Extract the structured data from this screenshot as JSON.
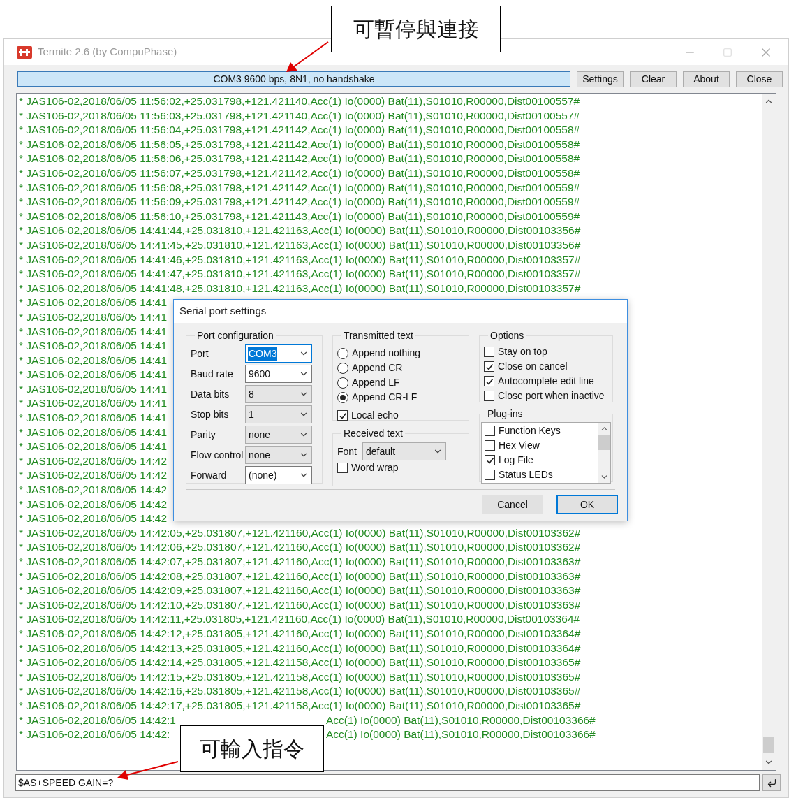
{
  "callouts": [
    {
      "text": "可暫停與連接"
    },
    {
      "text": "可輸入指令"
    }
  ],
  "window": {
    "title": "Termite 2.6 (by CompuPhase)"
  },
  "toolbar": {
    "status": "COM3 9600 bps, 8N1, no handshake",
    "buttons": [
      "Settings",
      "Clear",
      "About",
      "Close"
    ]
  },
  "log": {
    "lines": [
      {
        "text": "* JAS106-02,2018/06/05 11:56:02,+25.031798,+121.421140,Acc(1) Io(0000) Bat(11),S01010,R00000,Dist00100557#"
      },
      {
        "text": "* JAS106-02,2018/06/05 11:56:03,+25.031798,+121.421140,Acc(1) Io(0000) Bat(11),S01010,R00000,Dist00100557#"
      },
      {
        "text": "* JAS106-02,2018/06/05 11:56:04,+25.031798,+121.421142,Acc(1) Io(0000) Bat(11),S01010,R00000,Dist00100558#"
      },
      {
        "text": "* JAS106-02,2018/06/05 11:56:05,+25.031798,+121.421142,Acc(1) Io(0000) Bat(11),S01010,R00000,Dist00100558#"
      },
      {
        "text": "* JAS106-02,2018/06/05 11:56:06,+25.031798,+121.421142,Acc(1) Io(0000) Bat(11),S01010,R00000,Dist00100558#"
      },
      {
        "text": "* JAS106-02,2018/06/05 11:56:07,+25.031798,+121.421142,Acc(1) Io(0000) Bat(11),S01010,R00000,Dist00100558#"
      },
      {
        "text": "* JAS106-02,2018/06/05 11:56:08,+25.031798,+121.421142,Acc(1) Io(0000) Bat(11),S01010,R00000,Dist00100559#"
      },
      {
        "text": "* JAS106-02,2018/06/05 11:56:09,+25.031798,+121.421142,Acc(1) Io(0000) Bat(11),S01010,R00000,Dist00100559#"
      },
      {
        "text": "* JAS106-02,2018/06/05 11:56:10,+25.031798,+121.421143,Acc(1) Io(0000) Bat(11),S01010,R00000,Dist00100559#"
      },
      {
        "text": "* JAS106-02,2018/06/05 14:41:44,+25.031810,+121.421163,Acc(1) Io(0000) Bat(11),S01010,R00000,Dist00103356#"
      },
      {
        "text": "* JAS106-02,2018/06/05 14:41:45,+25.031810,+121.421163,Acc(1) Io(0000) Bat(11),S01010,R00000,Dist00103356#"
      },
      {
        "text": "* JAS106-02,2018/06/05 14:41:46,+25.031810,+121.421163,Acc(1) Io(0000) Bat(11),S01010,R00000,Dist00103357#"
      },
      {
        "text": "* JAS106-02,2018/06/05 14:41:47,+25.031810,+121.421163,Acc(1) Io(0000) Bat(11),S01010,R00000,Dist00103357#"
      },
      {
        "text": "* JAS106-02,2018/06/05 14:41:48,+25.031810,+121.421163,Acc(1) Io(0000) Bat(11),S01010,R00000,Dist00103357#"
      },
      {
        "text": "* JAS106-02,2018/06/05 14:41"
      },
      {
        "text": "* JAS106-02,2018/06/05 14:41"
      },
      {
        "text": "* JAS106-02,2018/06/05 14:41"
      },
      {
        "text": "* JAS106-02,2018/06/05 14:41"
      },
      {
        "text": "* JAS106-02,2018/06/05 14:41"
      },
      {
        "text": "* JAS106-02,2018/06/05 14:41"
      },
      {
        "text": "* JAS106-02,2018/06/05 14:41"
      },
      {
        "text": "* JAS106-02,2018/06/05 14:41"
      },
      {
        "text": "* JAS106-02,2018/06/05 14:41"
      },
      {
        "text": "* JAS106-02,2018/06/05 14:41"
      },
      {
        "text": "* JAS106-02,2018/06/05 14:41"
      },
      {
        "text": "* JAS106-02,2018/06/05 14:42"
      },
      {
        "text": "* JAS106-02,2018/06/05 14:42"
      },
      {
        "text": "* JAS106-02,2018/06/05 14:42"
      },
      {
        "text": "* JAS106-02,2018/06/05 14:42"
      },
      {
        "text": "* JAS106-02,2018/06/05 14:42"
      },
      {
        "text": "* JAS106-02,2018/06/05 14:42:05,+25.031807,+121.421160,Acc(1) Io(0000) Bat(11),S01010,R00000,Dist00103362#"
      },
      {
        "text": "* JAS106-02,2018/06/05 14:42:06,+25.031807,+121.421160,Acc(1) Io(0000) Bat(11),S01010,R00000,Dist00103362#"
      },
      {
        "text": "* JAS106-02,2018/06/05 14:42:07,+25.031807,+121.421160,Acc(1) Io(0000) Bat(11),S01010,R00000,Dist00103363#"
      },
      {
        "text": "* JAS106-02,2018/06/05 14:42:08,+25.031807,+121.421160,Acc(1) Io(0000) Bat(11),S01010,R00000,Dist00103363#"
      },
      {
        "text": "* JAS106-02,2018/06/05 14:42:09,+25.031807,+121.421160,Acc(1) Io(0000) Bat(11),S01010,R00000,Dist00103363#"
      },
      {
        "text": "* JAS106-02,2018/06/05 14:42:10,+25.031807,+121.421160,Acc(1) Io(0000) Bat(11),S01010,R00000,Dist00103363#"
      },
      {
        "text": "* JAS106-02,2018/06/05 14:42:11,+25.031805,+121.421160,Acc(1) Io(0000) Bat(11),S01010,R00000,Dist00103364#"
      },
      {
        "text": "* JAS106-02,2018/06/05 14:42:12,+25.031805,+121.421160,Acc(1) Io(0000) Bat(11),S01010,R00000,Dist00103364#"
      },
      {
        "text": "* JAS106-02,2018/06/05 14:42:13,+25.031805,+121.421160,Acc(1) Io(0000) Bat(11),S01010,R00000,Dist00103364#"
      },
      {
        "text": "* JAS106-02,2018/06/05 14:42:14,+25.031805,+121.421158,Acc(1) Io(0000) Bat(11),S01010,R00000,Dist00103365#"
      },
      {
        "text": "* JAS106-02,2018/06/05 14:42:15,+25.031805,+121.421158,Acc(1) Io(0000) Bat(11),S01010,R00000,Dist00103365#"
      },
      {
        "text": "* JAS106-02,2018/06/05 14:42:16,+25.031805,+121.421158,Acc(1) Io(0000) Bat(11),S01010,R00000,Dist00103365#"
      },
      {
        "text": "* JAS106-02,2018/06/05 14:42:17,+25.031805,+121.421158,Acc(1) Io(0000) Bat(11),S01010,R00000,Dist00103365#"
      },
      {
        "text": "* JAS106-02,2018/06/05 14:42:1",
        "tail": "Acc(1) Io(0000) Bat(11),S01010,R00000,Dist00103366#"
      },
      {
        "text": "* JAS106-02,2018/06/05 14:42:",
        "tail": "Acc(1) Io(0000) Bat(11),S01010,R00000,Dist00103366#"
      }
    ]
  },
  "command_input": {
    "value": "$AS+SPEED GAIN=?"
  },
  "dialog": {
    "title": "Serial port settings",
    "port_configuration": {
      "title": "Port configuration",
      "fields": [
        {
          "label": "Port",
          "value": "COM3",
          "kind": "editable",
          "focused": true
        },
        {
          "label": "Baud rate",
          "value": "9600",
          "kind": "editable",
          "focused": false
        },
        {
          "label": "Data bits",
          "value": "8",
          "kind": "list",
          "focused": false
        },
        {
          "label": "Stop bits",
          "value": "1",
          "kind": "list",
          "focused": false
        },
        {
          "label": "Parity",
          "value": "none",
          "kind": "list",
          "focused": false
        },
        {
          "label": "Flow control",
          "value": "none",
          "kind": "list",
          "focused": false
        },
        {
          "label": "Forward",
          "value": "(none)",
          "kind": "editable",
          "focused": false
        }
      ]
    },
    "transmitted_text": {
      "title": "Transmitted text",
      "options": [
        {
          "label": "Append nothing",
          "selected": false
        },
        {
          "label": "Append CR",
          "selected": false
        },
        {
          "label": "Append LF",
          "selected": false
        },
        {
          "label": "Append CR-LF",
          "selected": true
        }
      ],
      "local_echo": {
        "label": "Local echo",
        "checked": true
      }
    },
    "received_text": {
      "title": "Received text",
      "font": {
        "label": "Font",
        "value": "default"
      },
      "word_wrap": {
        "label": "Word wrap",
        "checked": false
      }
    },
    "options": {
      "title": "Options",
      "items": [
        {
          "label": "Stay on top",
          "checked": false
        },
        {
          "label": "Close on cancel",
          "checked": true
        },
        {
          "label": "Autocomplete edit line",
          "checked": true
        },
        {
          "label": "Close port when inactive",
          "checked": false
        }
      ]
    },
    "plugins": {
      "title": "Plug-ins",
      "items": [
        {
          "label": "Function Keys",
          "checked": false
        },
        {
          "label": "Hex View",
          "checked": false
        },
        {
          "label": "Log File",
          "checked": true
        },
        {
          "label": "Status LEDs",
          "checked": false
        }
      ]
    },
    "buttons": [
      {
        "label": "Cancel",
        "default": false
      },
      {
        "label": "OK",
        "default": true
      }
    ]
  }
}
